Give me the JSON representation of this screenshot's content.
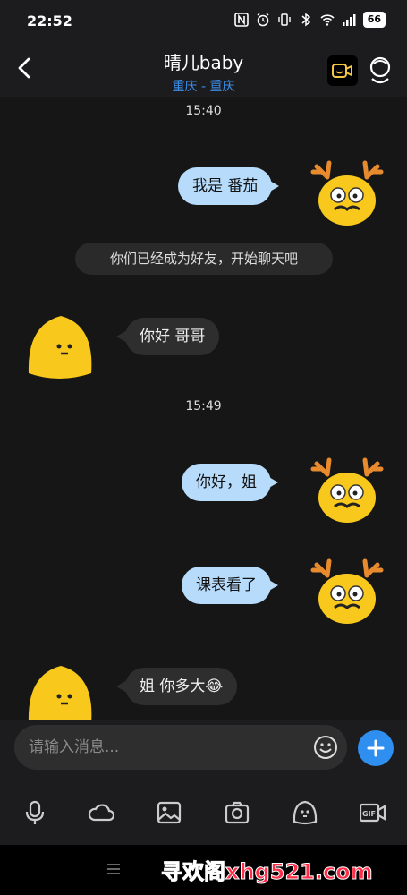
{
  "status": {
    "time": "22:52",
    "battery": "66"
  },
  "header": {
    "title": "晴儿baby",
    "subtitle": "重庆 - 重庆"
  },
  "messages": {
    "t1": "15:40",
    "m1": "我是 番茄",
    "system": "你们已经成为好友，开始聊天吧",
    "m2": "你好 哥哥",
    "t2": "15:49",
    "m3": "你好，姐",
    "m4": "课表看了",
    "m5": "姐 你多大😂"
  },
  "input": {
    "placeholder": "请输入消息..."
  },
  "toolbar": [
    "mic-icon",
    "cloud-icon",
    "image-icon",
    "camera-icon",
    "sticker-icon",
    "gif-icon"
  ],
  "watermark": "寻欢阁xhg521.com",
  "colors": {
    "my_bubble": "#b6dbfb",
    "their_bubble": "#2e2e2e",
    "accent": "#2f8ff0",
    "subtitle": "#3b8de8"
  }
}
